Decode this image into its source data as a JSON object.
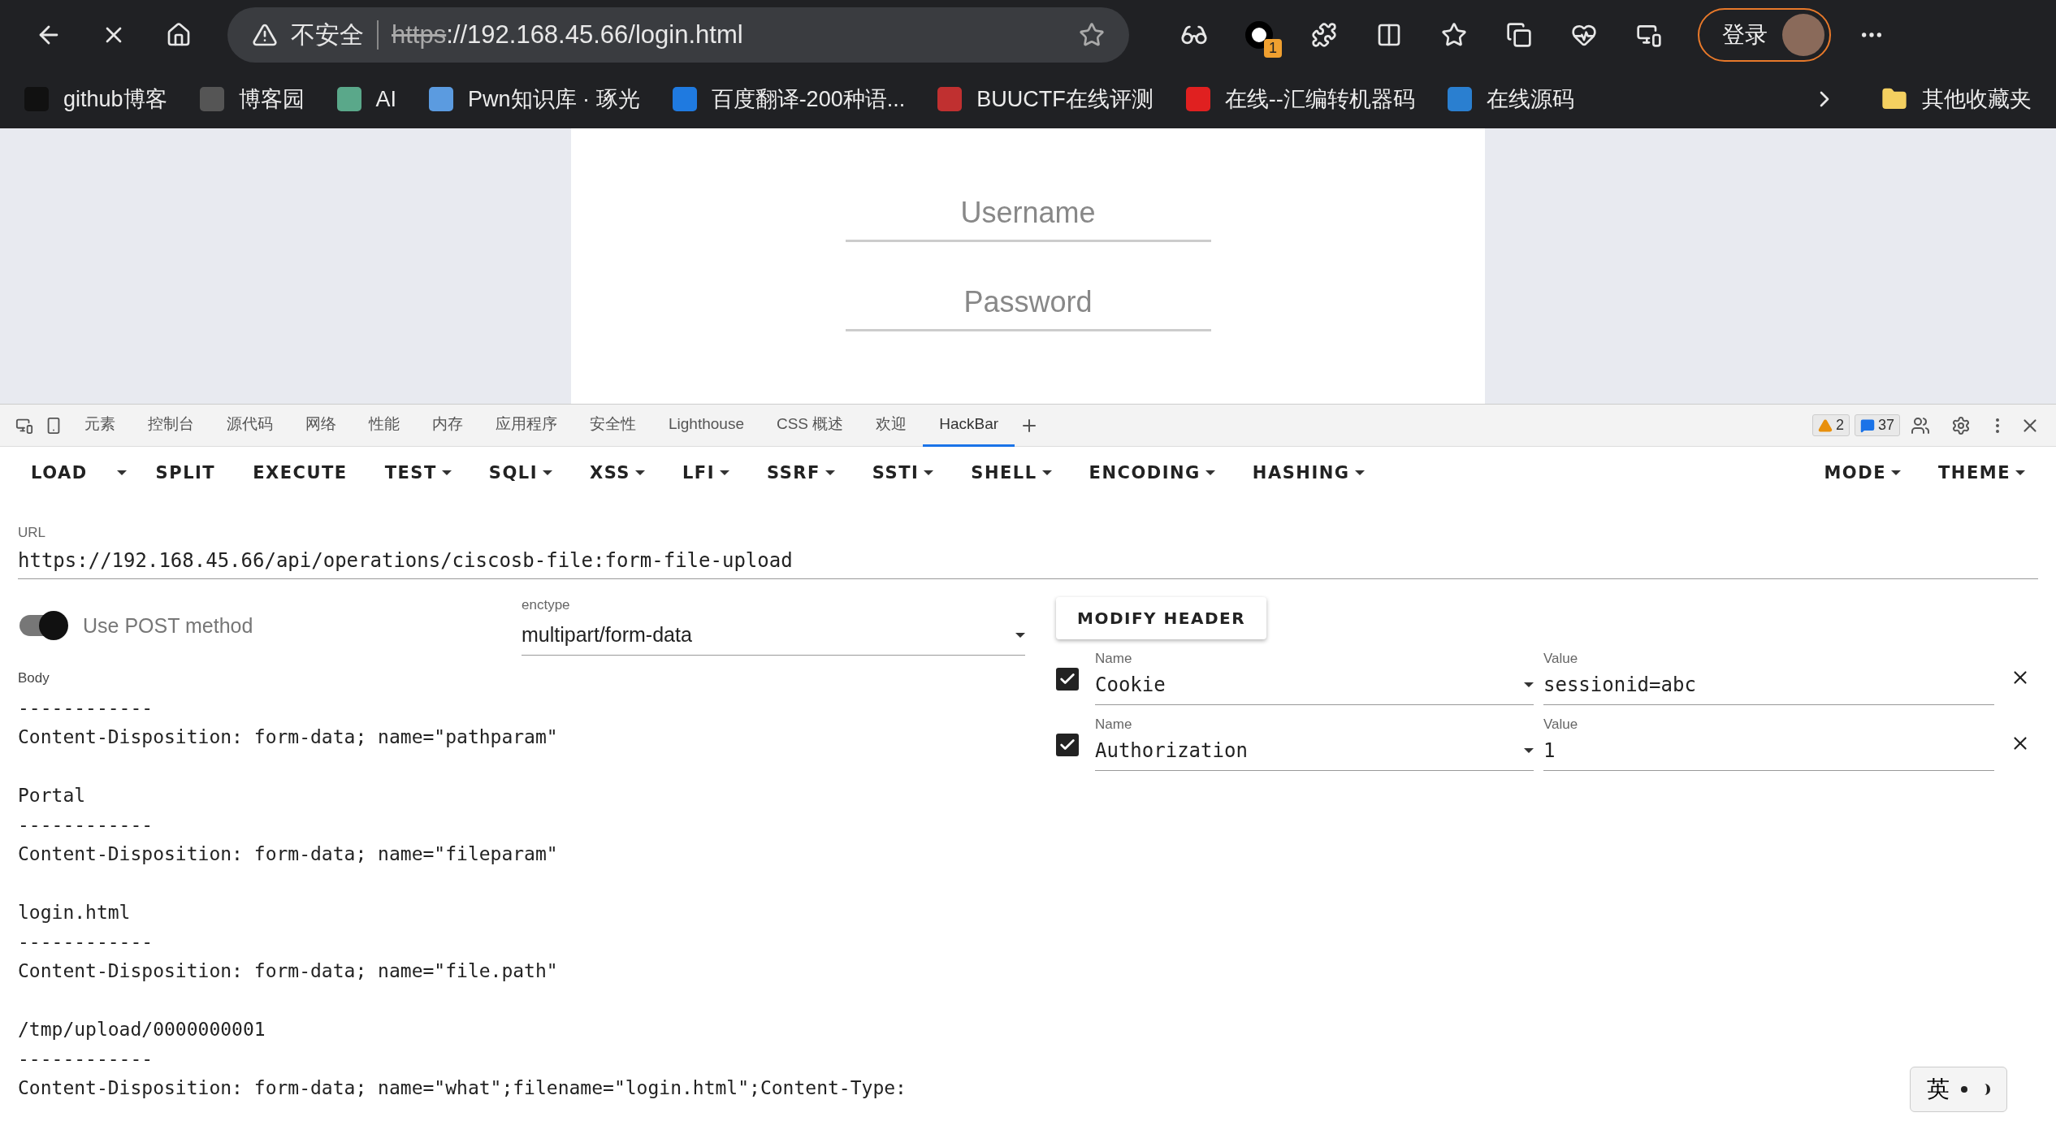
{
  "browser": {
    "security_label": "不安全",
    "url_scheme": "https",
    "url_rest": "://192.168.45.66/login.html",
    "extension_badge": "1",
    "profile_button": "登录"
  },
  "bookmarks": [
    {
      "label": "github博客"
    },
    {
      "label": "博客园"
    },
    {
      "label": "AI"
    },
    {
      "label": "Pwn知识库 · 琢光"
    },
    {
      "label": "百度翻译-200种语..."
    },
    {
      "label": "BUUCTF在线评测"
    },
    {
      "label": "在线--汇编转机器码"
    },
    {
      "label": "在线源码"
    }
  ],
  "other_bookmarks": "其他收藏夹",
  "page": {
    "username_placeholder": "Username",
    "password_placeholder": "Password"
  },
  "devtools": {
    "tabs": [
      {
        "label": "元素",
        "selected": false
      },
      {
        "label": "控制台",
        "selected": false
      },
      {
        "label": "源代码",
        "selected": false
      },
      {
        "label": "网络",
        "selected": false
      },
      {
        "label": "性能",
        "selected": false
      },
      {
        "label": "内存",
        "selected": false
      },
      {
        "label": "应用程序",
        "selected": false
      },
      {
        "label": "安全性",
        "selected": false
      },
      {
        "label": "Lighthouse",
        "selected": false
      },
      {
        "label": "CSS 概述",
        "selected": false
      },
      {
        "label": "欢迎",
        "selected": false
      },
      {
        "label": "HackBar",
        "selected": true
      }
    ],
    "warnings": "2",
    "messages": "37"
  },
  "hackbar": {
    "menu": [
      {
        "label": "LOAD",
        "kind": "split"
      },
      {
        "label": "SPLIT",
        "kind": "plain"
      },
      {
        "label": "EXECUTE",
        "kind": "plain"
      },
      {
        "label": "TEST",
        "kind": "dropdown"
      },
      {
        "label": "SQLI",
        "kind": "dropdown"
      },
      {
        "label": "XSS",
        "kind": "dropdown"
      },
      {
        "label": "LFI",
        "kind": "dropdown"
      },
      {
        "label": "SSRF",
        "kind": "dropdown"
      },
      {
        "label": "SSTI",
        "kind": "dropdown"
      },
      {
        "label": "SHELL",
        "kind": "dropdown"
      },
      {
        "label": "ENCODING",
        "kind": "dropdown"
      },
      {
        "label": "HASHING",
        "kind": "dropdown"
      }
    ],
    "right_menu": [
      {
        "label": "MODE",
        "kind": "dropdown"
      },
      {
        "label": "THEME",
        "kind": "dropdown"
      }
    ],
    "url_label": "URL",
    "url": "https://192.168.45.66/api/operations/ciscosb-file:form-file-upload",
    "post_method": {
      "label": "Use POST method",
      "on": true
    },
    "enctype": {
      "label": "enctype",
      "value": "multipart/form-data"
    },
    "body_label": "Body",
    "body_paragraphs": [
      [
        "------------",
        "Content-Disposition: form-data; name=\"pathparam\""
      ],
      [
        "Portal",
        "------------",
        "Content-Disposition: form-data; name=\"fileparam\""
      ],
      [
        "login.html",
        "------------",
        "Content-Disposition: form-data; name=\"file.path\""
      ],
      [
        "/tmp/upload/0000000001",
        "------------",
        "Content-Disposition: form-data; name=\"what\";filename=\"login.html\";Content-Type:"
      ]
    ],
    "modify_header": "MODIFY HEADER",
    "headers": [
      {
        "name_label": "Name",
        "name": "Cookie",
        "value_label": "Value",
        "value": "sessionid=abc",
        "checked": true
      },
      {
        "name_label": "Name",
        "name": "Authorization",
        "value_label": "Value",
        "value": "1",
        "checked": true
      }
    ]
  },
  "ime": {
    "label": "英"
  }
}
